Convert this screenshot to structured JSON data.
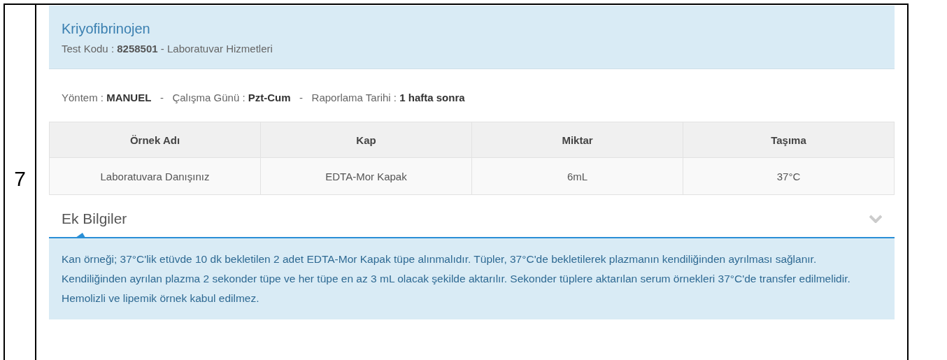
{
  "row_number": "7",
  "header": {
    "title": "Kriyofibrinojen",
    "subtitle": "Test Kodu : **8258501** - Laboratuvar Hizmetleri"
  },
  "meta": "Yöntem : **MANUEL**   -   Çalışma Günü : **Pzt-Cum**   -   Raporlama Tarihi : **1 hafta sonra**",
  "table": {
    "columns": [
      "Örnek Adı",
      "Kap",
      "Miktar",
      "Taşıma"
    ],
    "rows": [
      [
        "Laboratuvara Danışınız",
        "EDTA-Mor Kapak",
        "6mL",
        "37°C"
      ]
    ]
  },
  "additional_info": {
    "title": "Ek Bilgiler",
    "text": "Kan örneği; 37°C'lik etüvde 10 dk bekletilen 2 adet EDTA-Mor Kapak tüpe alınmalıdır. Tüpler, 37°C'de bekletilerek plazmanın kendiliğinden ayrılması sağlanır. Kendiliğinden ayrılan plazma 2 sekonder tüpe ve her tüpe en az 3 mL olacak şekilde aktarılır. Sekonder tüplere aktarılan serum örnekleri 37°C'de transfer edilmelidir. Hemolizli ve lipemik örnek kabul edilmez."
  }
}
